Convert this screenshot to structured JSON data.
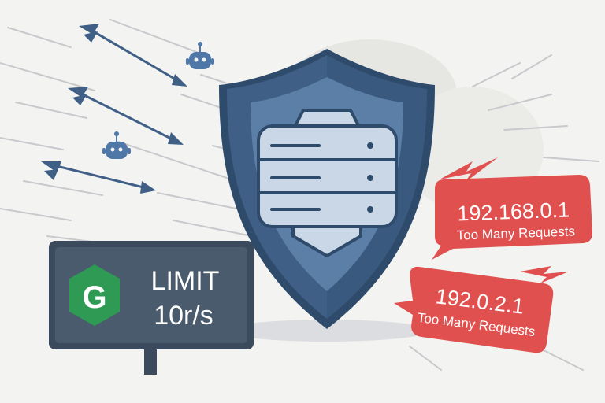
{
  "sign": {
    "logo_letter": "G",
    "line1": "LIMIT",
    "line2": "10r/s"
  },
  "blocked": [
    {
      "ip": "192.168.0.1",
      "message": "Too Many Requests"
    },
    {
      "ip": "192.0.2.1",
      "message": "Too Many Requests"
    }
  ],
  "colors": {
    "background": "#f3f3f1",
    "shield_dark": "#3f5f86",
    "shield_mid": "#5c7fa8",
    "shield_light": "#c9d7e6",
    "sign_panel": "#3b4a5c",
    "logo_green": "#2e9a53",
    "alert_red": "#e0504f",
    "arrow": "#3f5f86",
    "bot": "#4f77a8"
  },
  "icons": [
    "shield-icon",
    "server-icon",
    "bot-icon",
    "arrow-icon",
    "lightning-icon"
  ]
}
